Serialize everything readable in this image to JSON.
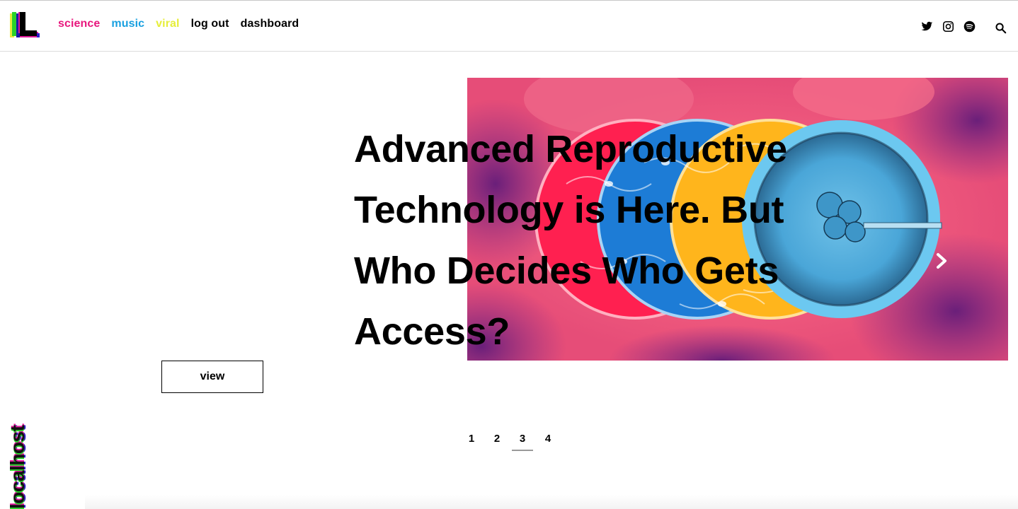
{
  "header": {
    "nav": [
      {
        "label": "science",
        "color": "#e8177d"
      },
      {
        "label": "music",
        "color": "#19a0e0"
      },
      {
        "label": "viral",
        "color": "#e6ee3a"
      },
      {
        "label": "log out",
        "color": "#000000"
      },
      {
        "label": "dashboard",
        "color": "#000000"
      }
    ],
    "social_icons": [
      "twitter-icon",
      "instagram-icon",
      "spotify-icon",
      "search-icon"
    ]
  },
  "hero": {
    "title": "Advanced Reproductive Technology is Here. But Who Decides Who Gets Access?",
    "view_label": "view",
    "image_description_colors": [
      "#e94f74",
      "#ff1f4b",
      "#1c7fd6",
      "#ffb81e",
      "#6cc8f0"
    ]
  },
  "pagination": {
    "pages": [
      "1",
      "2",
      "3",
      "4"
    ],
    "active": "3"
  },
  "brand": {
    "side_text": "localhost"
  }
}
